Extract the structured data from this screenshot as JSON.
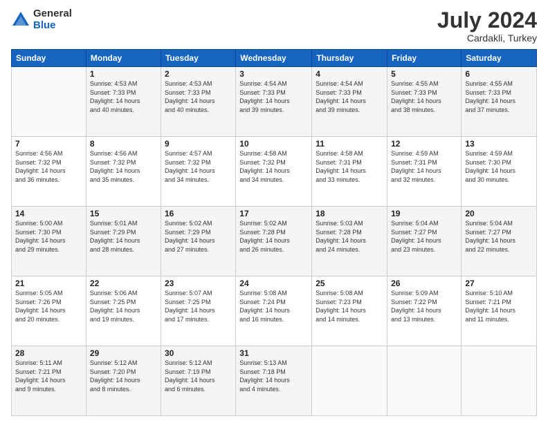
{
  "logo": {
    "general": "General",
    "blue": "Blue"
  },
  "title": {
    "month_year": "July 2024",
    "location": "Cardakli, Turkey"
  },
  "header_days": [
    "Sunday",
    "Monday",
    "Tuesday",
    "Wednesday",
    "Thursday",
    "Friday",
    "Saturday"
  ],
  "weeks": [
    [
      {
        "day": "",
        "info": ""
      },
      {
        "day": "1",
        "info": "Sunrise: 4:53 AM\nSunset: 7:33 PM\nDaylight: 14 hours\nand 40 minutes."
      },
      {
        "day": "2",
        "info": "Sunrise: 4:53 AM\nSunset: 7:33 PM\nDaylight: 14 hours\nand 40 minutes."
      },
      {
        "day": "3",
        "info": "Sunrise: 4:54 AM\nSunset: 7:33 PM\nDaylight: 14 hours\nand 39 minutes."
      },
      {
        "day": "4",
        "info": "Sunrise: 4:54 AM\nSunset: 7:33 PM\nDaylight: 14 hours\nand 39 minutes."
      },
      {
        "day": "5",
        "info": "Sunrise: 4:55 AM\nSunset: 7:33 PM\nDaylight: 14 hours\nand 38 minutes."
      },
      {
        "day": "6",
        "info": "Sunrise: 4:55 AM\nSunset: 7:33 PM\nDaylight: 14 hours\nand 37 minutes."
      }
    ],
    [
      {
        "day": "7",
        "info": "Sunrise: 4:56 AM\nSunset: 7:32 PM\nDaylight: 14 hours\nand 36 minutes."
      },
      {
        "day": "8",
        "info": "Sunrise: 4:56 AM\nSunset: 7:32 PM\nDaylight: 14 hours\nand 35 minutes."
      },
      {
        "day": "9",
        "info": "Sunrise: 4:57 AM\nSunset: 7:32 PM\nDaylight: 14 hours\nand 34 minutes."
      },
      {
        "day": "10",
        "info": "Sunrise: 4:58 AM\nSunset: 7:32 PM\nDaylight: 14 hours\nand 34 minutes."
      },
      {
        "day": "11",
        "info": "Sunrise: 4:58 AM\nSunset: 7:31 PM\nDaylight: 14 hours\nand 33 minutes."
      },
      {
        "day": "12",
        "info": "Sunrise: 4:59 AM\nSunset: 7:31 PM\nDaylight: 14 hours\nand 32 minutes."
      },
      {
        "day": "13",
        "info": "Sunrise: 4:59 AM\nSunset: 7:30 PM\nDaylight: 14 hours\nand 30 minutes."
      }
    ],
    [
      {
        "day": "14",
        "info": "Sunrise: 5:00 AM\nSunset: 7:30 PM\nDaylight: 14 hours\nand 29 minutes."
      },
      {
        "day": "15",
        "info": "Sunrise: 5:01 AM\nSunset: 7:29 PM\nDaylight: 14 hours\nand 28 minutes."
      },
      {
        "day": "16",
        "info": "Sunrise: 5:02 AM\nSunset: 7:29 PM\nDaylight: 14 hours\nand 27 minutes."
      },
      {
        "day": "17",
        "info": "Sunrise: 5:02 AM\nSunset: 7:28 PM\nDaylight: 14 hours\nand 26 minutes."
      },
      {
        "day": "18",
        "info": "Sunrise: 5:03 AM\nSunset: 7:28 PM\nDaylight: 14 hours\nand 24 minutes."
      },
      {
        "day": "19",
        "info": "Sunrise: 5:04 AM\nSunset: 7:27 PM\nDaylight: 14 hours\nand 23 minutes."
      },
      {
        "day": "20",
        "info": "Sunrise: 5:04 AM\nSunset: 7:27 PM\nDaylight: 14 hours\nand 22 minutes."
      }
    ],
    [
      {
        "day": "21",
        "info": "Sunrise: 5:05 AM\nSunset: 7:26 PM\nDaylight: 14 hours\nand 20 minutes."
      },
      {
        "day": "22",
        "info": "Sunrise: 5:06 AM\nSunset: 7:25 PM\nDaylight: 14 hours\nand 19 minutes."
      },
      {
        "day": "23",
        "info": "Sunrise: 5:07 AM\nSunset: 7:25 PM\nDaylight: 14 hours\nand 17 minutes."
      },
      {
        "day": "24",
        "info": "Sunrise: 5:08 AM\nSunset: 7:24 PM\nDaylight: 14 hours\nand 16 minutes."
      },
      {
        "day": "25",
        "info": "Sunrise: 5:08 AM\nSunset: 7:23 PM\nDaylight: 14 hours\nand 14 minutes."
      },
      {
        "day": "26",
        "info": "Sunrise: 5:09 AM\nSunset: 7:22 PM\nDaylight: 14 hours\nand 13 minutes."
      },
      {
        "day": "27",
        "info": "Sunrise: 5:10 AM\nSunset: 7:21 PM\nDaylight: 14 hours\nand 11 minutes."
      }
    ],
    [
      {
        "day": "28",
        "info": "Sunrise: 5:11 AM\nSunset: 7:21 PM\nDaylight: 14 hours\nand 9 minutes."
      },
      {
        "day": "29",
        "info": "Sunrise: 5:12 AM\nSunset: 7:20 PM\nDaylight: 14 hours\nand 8 minutes."
      },
      {
        "day": "30",
        "info": "Sunrise: 5:12 AM\nSunset: 7:19 PM\nDaylight: 14 hours\nand 6 minutes."
      },
      {
        "day": "31",
        "info": "Sunrise: 5:13 AM\nSunset: 7:18 PM\nDaylight: 14 hours\nand 4 minutes."
      },
      {
        "day": "",
        "info": ""
      },
      {
        "day": "",
        "info": ""
      },
      {
        "day": "",
        "info": ""
      }
    ]
  ]
}
